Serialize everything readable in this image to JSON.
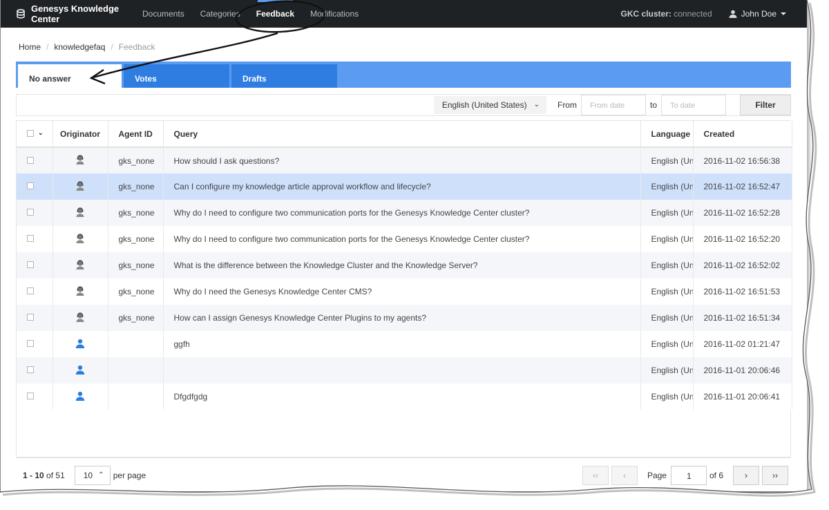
{
  "navbar": {
    "brand": "Genesys Knowledge Center",
    "links": [
      "Documents",
      "Categories",
      "Feedback",
      "Modifications"
    ],
    "active": "Feedback",
    "cluster_label": "GKC cluster:",
    "cluster_status": "connected",
    "user": "John Doe"
  },
  "breadcrumb": [
    "Home",
    "knowledgefaq",
    "Feedback"
  ],
  "tabs": [
    "No answer",
    "Votes",
    "Drafts"
  ],
  "filter": {
    "language": "English (United States)",
    "from_label": "From",
    "from_placeholder": "From date",
    "to_label": "to",
    "to_placeholder": "To date",
    "button": "Filter"
  },
  "table": {
    "headers": [
      "Originator",
      "Agent ID",
      "Query",
      "Language",
      "Created"
    ],
    "rows": [
      {
        "originator": "agent-icon",
        "agent": "gks_none",
        "query": "How should I ask questions?",
        "language": "English (Un",
        "created": "2016-11-02 16:56:38"
      },
      {
        "originator": "agent-icon",
        "agent": "gks_none",
        "query": "Can I configure my knowledge article approval workflow and lifecycle?",
        "language": "English (Un",
        "created": "2016-11-02 16:52:47"
      },
      {
        "originator": "agent-icon",
        "agent": "gks_none",
        "query": "Why do I need to configure two communication ports for the Genesys Knowledge Center cluster?",
        "language": "English (Un",
        "created": "2016-11-02 16:52:28"
      },
      {
        "originator": "agent-icon",
        "agent": "gks_none",
        "query": "Why do I need to configure two communication ports for the Genesys Knowledge Center cluster?",
        "language": "English (Un",
        "created": "2016-11-02 16:52:20"
      },
      {
        "originator": "agent-icon",
        "agent": "gks_none",
        "query": "What is the difference between the Knowledge Cluster and the Knowledge Server?",
        "language": "English (Un",
        "created": "2016-11-02 16:52:02"
      },
      {
        "originator": "agent-icon",
        "agent": "gks_none",
        "query": "Why do I need the Genesys Knowledge Center CMS?",
        "language": "English (Un",
        "created": "2016-11-02 16:51:53"
      },
      {
        "originator": "agent-icon",
        "agent": "gks_none",
        "query": "How can I assign Genesys Knowledge Center Plugins to my agents?",
        "language": "English (Un",
        "created": "2016-11-02 16:51:34"
      },
      {
        "originator": "user-icon",
        "agent": "",
        "query": "ggfh",
        "language": "English (Un",
        "created": "2016-11-02 01:21:47"
      },
      {
        "originator": "user-icon",
        "agent": "",
        "query": "",
        "language": "English (Un",
        "created": "2016-11-01 20:06:46"
      },
      {
        "originator": "user-icon",
        "agent": "",
        "query": "Dfgdfgdg",
        "language": "English (Un",
        "created": "2016-11-01 20:06:41"
      }
    ]
  },
  "footer": {
    "range": "1 - 10",
    "of_label": "of",
    "total": "51",
    "per_page_value": "10",
    "per_page_label": "per page",
    "page_label": "Page",
    "page_value": "1",
    "page_of": "of 6"
  },
  "colors": {
    "navbar_bg": "#1f2225",
    "tab_bar": "#5b9cf2",
    "tab_inactive": "#2f7de0",
    "selected_row": "#cfe0fb",
    "agent_icon": "#666666",
    "user_icon": "#2f7de0"
  }
}
